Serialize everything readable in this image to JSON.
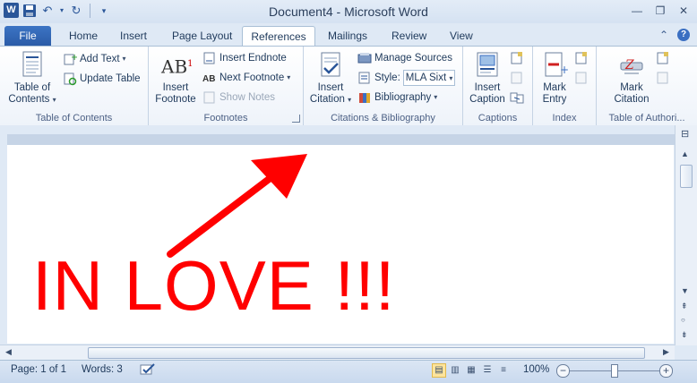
{
  "window": {
    "title": "Document4  -  Microsoft Word"
  },
  "tabs": [
    "File",
    "Home",
    "Insert",
    "Page Layout",
    "References",
    "Mailings",
    "Review",
    "View"
  ],
  "active_tab": "References",
  "ribbon": {
    "toc": {
      "big_label_1": "Table of",
      "big_label_2": "Contents",
      "add_text": "Add Text",
      "update_table": "Update Table",
      "group_label": "Table of Contents"
    },
    "footnotes": {
      "big_label_1": "Insert",
      "big_label_2": "Footnote",
      "insert_endnote": "Insert Endnote",
      "next_footnote": "Next Footnote",
      "show_notes": "Show Notes",
      "group_label": "Footnotes"
    },
    "citations": {
      "big_label_1": "Insert",
      "big_label_2": "Citation",
      "manage_sources": "Manage Sources",
      "style_label": "Style:",
      "style_value": "MLA Sixt",
      "bibliography": "Bibliography",
      "group_label": "Citations & Bibliography"
    },
    "captions": {
      "big_label_1": "Insert",
      "big_label_2": "Caption",
      "group_label": "Captions"
    },
    "index": {
      "big_label_1": "Mark",
      "big_label_2": "Entry",
      "group_label": "Index"
    },
    "toa": {
      "big_label_1": "Mark",
      "big_label_2": "Citation",
      "group_label": "Table of Authori..."
    }
  },
  "document": {
    "text": "IN LOVE !!!"
  },
  "status": {
    "page": "Page: 1 of 1",
    "words": "Words: 3",
    "zoom": "100%",
    "zoom_level_percent": 100
  },
  "colors": {
    "accent": "#2a5699",
    "doc_text": "#ff0000"
  }
}
